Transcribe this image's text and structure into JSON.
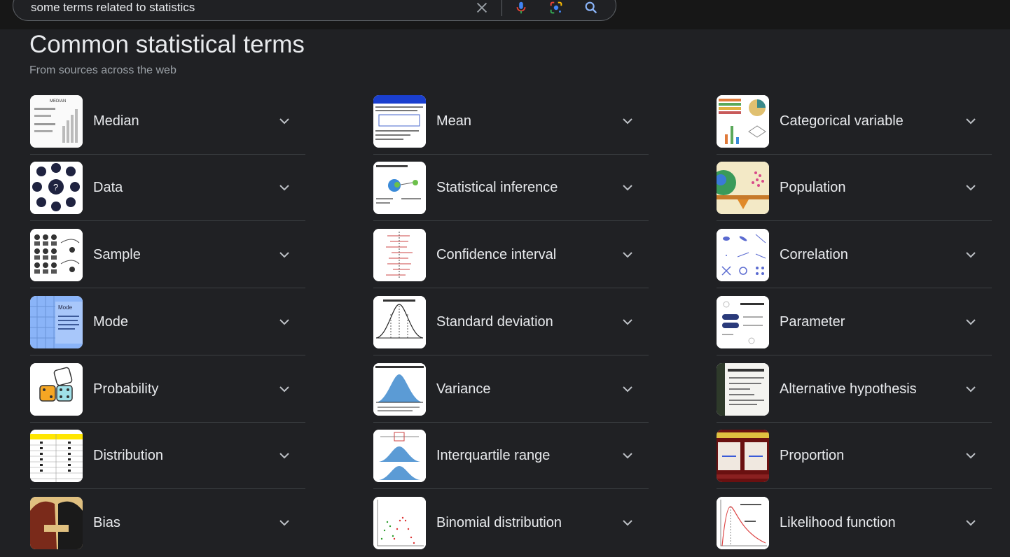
{
  "search": {
    "query": "some terms related to statistics"
  },
  "header": {
    "title": "Common statistical terms",
    "subtitle": "From sources across the web"
  },
  "columns": [
    {
      "items": [
        {
          "label": "Median",
          "thumb": "median-chart"
        },
        {
          "label": "Data",
          "thumb": "data-icons"
        },
        {
          "label": "Sample",
          "thumb": "sample-diagram"
        },
        {
          "label": "Mode",
          "thumb": "mode-card"
        },
        {
          "label": "Probability",
          "thumb": "dice"
        },
        {
          "label": "Distribution",
          "thumb": "frequency-table"
        },
        {
          "label": "Bias",
          "thumb": "bias-illustration"
        }
      ]
    },
    {
      "items": [
        {
          "label": "Mean",
          "thumb": "mean-formula"
        },
        {
          "label": "Statistical inference",
          "thumb": "inference-diagram"
        },
        {
          "label": "Confidence interval",
          "thumb": "confidence-plot"
        },
        {
          "label": "Standard deviation",
          "thumb": "normal-curve"
        },
        {
          "label": "Variance",
          "thumb": "variance-curve"
        },
        {
          "label": "Interquartile range",
          "thumb": "iqr-curve"
        },
        {
          "label": "Binomial distribution",
          "thumb": "binomial-plot"
        }
      ]
    },
    {
      "items": [
        {
          "label": "Categorical variable",
          "thumb": "categorical-charts"
        },
        {
          "label": "Population",
          "thumb": "population-scale"
        },
        {
          "label": "Correlation",
          "thumb": "scatter-grid"
        },
        {
          "label": "Parameter",
          "thumb": "parameter-card"
        },
        {
          "label": "Alternative hypothesis",
          "thumb": "hypothesis-slide"
        },
        {
          "label": "Proportion",
          "thumb": "proportion-slide"
        },
        {
          "label": "Likelihood function",
          "thumb": "likelihood-plot"
        }
      ]
    }
  ],
  "colors": {
    "background": "#202124",
    "topbar": "#171717",
    "text": "#e8eaed",
    "muted": "#9aa0a6",
    "divider": "#3c4043"
  },
  "icons": [
    "clear-icon",
    "mic-icon",
    "lens-icon",
    "search-icon",
    "chevron-down-icon"
  ]
}
